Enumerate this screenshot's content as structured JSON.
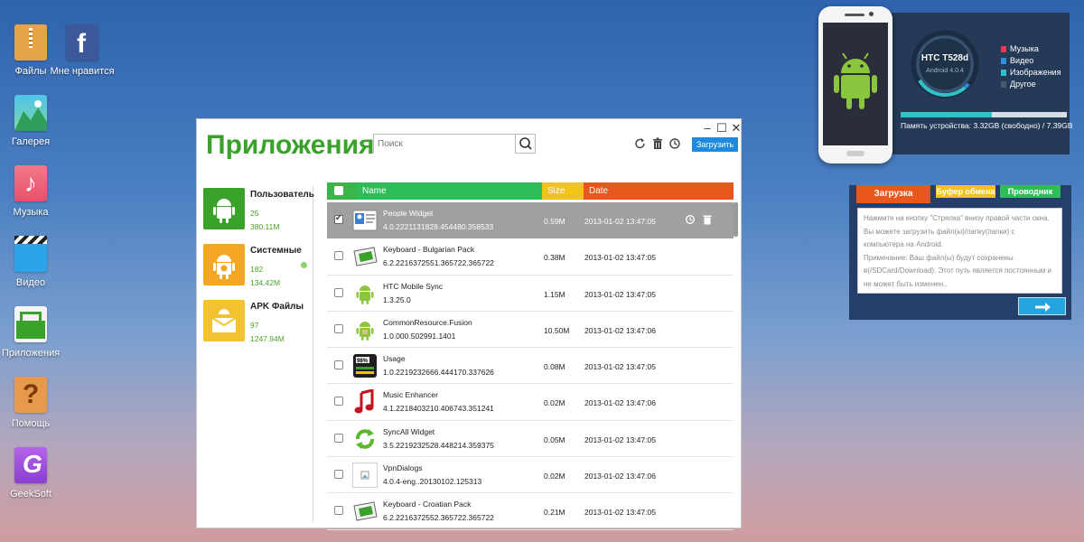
{
  "desktop": {
    "icons": [
      {
        "label": "Файлы",
        "icon": "files-icon"
      },
      {
        "label": "Мне нравится",
        "icon": "facebook-icon"
      },
      {
        "label": "Галерея",
        "icon": "gallery-icon"
      },
      {
        "label": "Музыка",
        "icon": "music-icon"
      },
      {
        "label": "Видео",
        "icon": "video-icon"
      },
      {
        "label": "Приложения",
        "icon": "apps-icon"
      },
      {
        "label": "Помощь",
        "icon": "help-icon"
      },
      {
        "label": "GeekSoft",
        "icon": "geeksoft-icon"
      }
    ]
  },
  "window": {
    "title": "Приложения",
    "search_placeholder": "Поиск",
    "upload_label": "Загрузить",
    "controls": {
      "minimize": "–",
      "maximize": "☐",
      "close": "✕"
    }
  },
  "categories": [
    {
      "name": "Пользователь",
      "count": "25",
      "size": "380.11M",
      "color": "#3aa12a"
    },
    {
      "name": "Системные",
      "count": "182",
      "size": "134.42M",
      "color": "#f5a623"
    },
    {
      "name": "APK Файлы",
      "count": "97",
      "size": "1247.94M",
      "color": "#f2c230"
    }
  ],
  "table": {
    "headers": {
      "name": "Name",
      "size": "Size",
      "date": "Date"
    },
    "header_colors": {
      "check": "#39b54a",
      "name": "#2ebd59",
      "size": "#f0c419",
      "date": "#e9571c"
    },
    "rows": [
      {
        "name": "People Widget",
        "version": "4.0.2221131828.454480.358533",
        "size": "0.59M",
        "date": "2013-01-02 13:47:05",
        "icon": "people-widget-icon",
        "selected": true
      },
      {
        "name": "Keyboard - Bulgarian Pack",
        "version": "6.2.2216372551.365722.365722",
        "size": "0.38M",
        "date": "2013-01-02 13:47:05",
        "icon": "keyboard-icon",
        "selected": false
      },
      {
        "name": "HTC Mobile Sync",
        "version": "1.3.25.0",
        "size": "1.15M",
        "date": "2013-01-02 13:47:05",
        "icon": "android-icon",
        "selected": false
      },
      {
        "name": "CommonResource.Fusion",
        "version": "1.0.000.502991.1401",
        "size": "10.50M",
        "date": "2013-01-02 13:47:06",
        "icon": "android-box-icon",
        "selected": false
      },
      {
        "name": "Usage",
        "version": "1.0.2219232666.444170.337626",
        "size": "0.08M",
        "date": "2013-01-02 13:47:05",
        "icon": "battery-usage-icon",
        "selected": false
      },
      {
        "name": "Music Enhancer",
        "version": "4.1.2218403210.406743.351241",
        "size": "0.02M",
        "date": "2013-01-02 13:47:06",
        "icon": "music-note-icon",
        "selected": false
      },
      {
        "name": "SyncAll Widget",
        "version": "3.5.2219232528.448214.359375",
        "size": "0.05M",
        "date": "2013-01-02 13:47:05",
        "icon": "sync-icon",
        "selected": false
      },
      {
        "name": "VpnDialogs",
        "version": "4.0.4-eng..20130102.125313",
        "size": "0.02M",
        "date": "2013-01-02 13:47:06",
        "icon": "broken-image-icon",
        "selected": false
      },
      {
        "name": "Keyboard - Croatian Pack",
        "version": "6.2.2216372552.365722.365722",
        "size": "0.21M",
        "date": "2013-01-02 13:47:05",
        "icon": "keyboard-icon",
        "selected": false
      }
    ]
  },
  "device": {
    "name": "HTC T528d",
    "os": "Android 4.0.4",
    "legend": [
      {
        "label": "Музыка",
        "color": "#e8384f"
      },
      {
        "label": "Видео",
        "color": "#2f8ee0"
      },
      {
        "label": "Изображения",
        "color": "#2dc4c8"
      },
      {
        "label": "Другое",
        "color": "#4a5a6e"
      }
    ],
    "memory_text": "Память устройства: 3.32GB (свободно) / 7.39GB",
    "memory_used_fraction": 0.55
  },
  "upload_panel": {
    "tabs": [
      {
        "label": "Загрузка",
        "bg": "#e9571c",
        "fg": "#ffffff"
      },
      {
        "label": "Буфер обмена",
        "bg": "#f0c419",
        "fg": "#ffffff"
      },
      {
        "label": "Проводник",
        "bg": "#2ebd59",
        "fg": "#ffffff"
      }
    ],
    "text_line1": "Нажмите на кнопку \"Стрелка\" внизу правой части окна. Вы можете загрузить файл(ы)/папку(папки) с компьютера на Android.",
    "text_line2": "Примечание: Ваш файл(ы) будут сохранены в(/SDCard/Download). Этот путь является постоянным и не может быть изменен..",
    "arrow": "➔"
  }
}
